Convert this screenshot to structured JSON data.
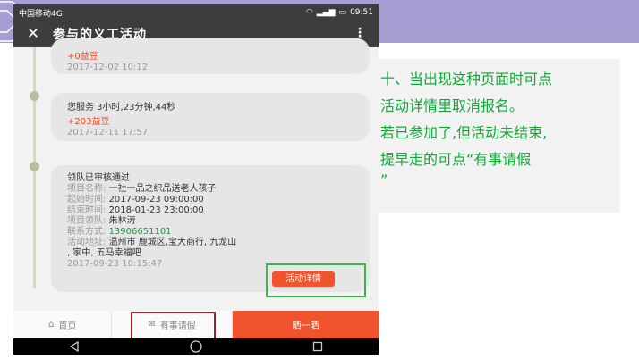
{
  "status_bar": {
    "carrier": "中国移动4G",
    "right_text": "09:51"
  },
  "app_bar": {
    "title": "参与的义工活动"
  },
  "entries": [
    {
      "points": "+0益豆",
      "time": "2017-12-02 10:12"
    },
    {
      "service": "您服务 3小时,23分钟,44秒",
      "points": "+203益豆",
      "time": "2017-12-11 17:57"
    }
  ],
  "approved": {
    "title": "领队已审核通过",
    "project_label": "项目名称:",
    "project_value": "一社一品之织品送老人孩子",
    "start_label": "起始时间:",
    "start_value": "2017-09-23 09:00:00",
    "end_label": "结束时间:",
    "end_value": "2018-01-23 23:00:00",
    "leader_label": "项目领队:",
    "leader_value": "朱林涛",
    "contact_label": "联系方式:",
    "contact_value": "13906651101",
    "address_label": "活动地址:",
    "address_value_line1": "温州市 鹿城区,宝大商行, 九龙山",
    "address_value_line2": ", 家中, 五马幸福吧",
    "time": "2017-09-23 10:15:47",
    "detail_button": "活动详情"
  },
  "bottom_bar": {
    "home": "首页",
    "leave": "有事请假",
    "share": "晒一晒"
  },
  "note": {
    "line1": "十、当出现这种页面时可点",
    "line2": "活动详情里取消报名。",
    "line3": "若已参加了,但活动未结束,",
    "line4": "提早走的可点“有事请假",
    "line5": "”"
  },
  "colors": {
    "accent": "#f0542e",
    "note_text": "#14a83a",
    "header": "#3d3d3d",
    "corner_band": "#a79ed4",
    "highlight_red": "#a6222c",
    "highlight_green": "#3ab54a"
  }
}
